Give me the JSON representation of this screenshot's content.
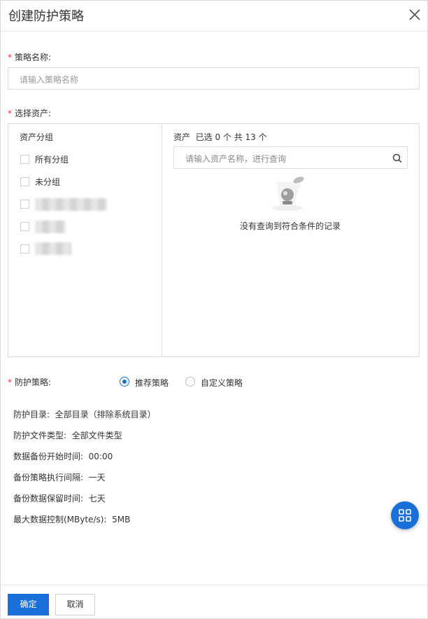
{
  "dialog": {
    "title": "创建防护策略"
  },
  "policy_name": {
    "label": "策略名称:",
    "placeholder": "请输入策略名称"
  },
  "assets": {
    "label": "选择资产:",
    "group_column_title": "资产分组",
    "groups": [
      {
        "label": "所有分组"
      },
      {
        "label": "未分组"
      }
    ],
    "asset_column_title": "资产  已选 0 个 共 13 个",
    "search_placeholder": "请输入资产名称，进行查询",
    "empty_text": "没有查询到符合条件的记录"
  },
  "protection": {
    "label": "防护策略:",
    "options": [
      {
        "label": "推荐策略",
        "selected": true
      },
      {
        "label": "自定义策略",
        "selected": false
      }
    ]
  },
  "details": [
    "防护目录:  全部目录（排除系统目录）",
    "防护文件类型:  全部文件类型",
    "数据备份开始时间:  00:00",
    "备份策略执行间隔:  一天",
    "备份数据保留时间:  七天",
    "最大数据控制(MByte/s):  5MB"
  ],
  "footer": {
    "confirm_label": "确定",
    "cancel_label": "取消"
  },
  "colors": {
    "accent": "#1a6fd8",
    "required": "#e33333"
  },
  "icons": {
    "close": "close-icon",
    "search": "search-icon",
    "fab": "grid-icon",
    "empty": "empty-state-illustration"
  }
}
